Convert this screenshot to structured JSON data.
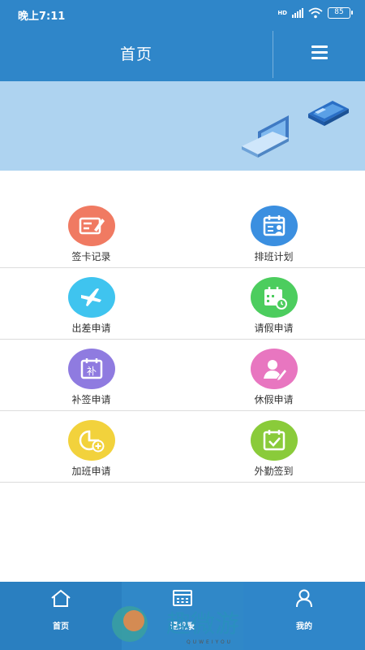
{
  "status": {
    "time": "晚上7:11",
    "battery": "85",
    "hd": "HD"
  },
  "header": {
    "title": "首页"
  },
  "grid": [
    [
      {
        "label": "签卡记录",
        "color": "#f07a62",
        "icon": "card-edit-icon"
      },
      {
        "label": "排班计划",
        "color": "#3b8fe0",
        "icon": "schedule-user-icon"
      }
    ],
    [
      {
        "label": "出差申请",
        "color": "#3fc4ef",
        "icon": "airplane-icon"
      },
      {
        "label": "请假申请",
        "color": "#4ccd5e",
        "icon": "calendar-clock-icon"
      }
    ],
    [
      {
        "label": "补签申请",
        "color": "#8f7be0",
        "icon": "calendar-supplement-icon"
      },
      {
        "label": "休假申请",
        "color": "#e876c0",
        "icon": "person-edit-icon"
      }
    ],
    [
      {
        "label": "加班申请",
        "color": "#f2d23c",
        "icon": "clock-plus-icon"
      },
      {
        "label": "外勤签到",
        "color": "#8acb3a",
        "icon": "calendar-check-icon"
      }
    ]
  ],
  "supplement_char": "补",
  "nav": [
    {
      "label": "首页",
      "icon": "home-icon"
    },
    {
      "label": "通讯录",
      "icon": "contacts-icon"
    },
    {
      "label": "我的",
      "icon": "user-icon"
    }
  ],
  "watermark": {
    "text": "趣微游",
    "sub": "QUWEIYOU"
  },
  "colors": {
    "primary": "#2f86c9",
    "banner": "#aed3f0"
  }
}
